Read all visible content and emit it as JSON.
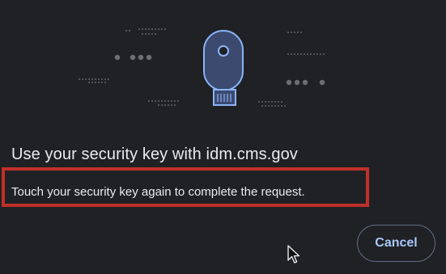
{
  "dialog": {
    "title": "Use your security key with idm.cms.gov",
    "message": "Touch your security key again to complete the request.",
    "cancel_label": "Cancel"
  },
  "illustration": {
    "icon": "usb-security-key-icon"
  },
  "colors": {
    "background": "#202124",
    "text": "#e8eaed",
    "accent": "#a8c7fa",
    "key_body": "#8ab4f8",
    "highlight": "#c0302a"
  }
}
